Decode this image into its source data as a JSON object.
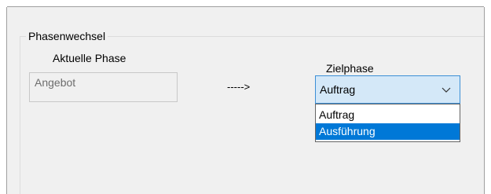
{
  "phase_change": {
    "group_title": "Phasenwechsel",
    "current_phase_label": "Aktuelle Phase",
    "current_phase_value": "Angebot",
    "arrow_text": "----->",
    "target_phase_label": "Zielphase",
    "target_phase_selected": "Auftrag",
    "target_phase_options": [
      "Auftrag",
      "Ausführung"
    ],
    "highlighted_option": "Ausführung",
    "icons": {
      "dropdown_arrow": "chevron-down-icon"
    },
    "colors": {
      "selection_highlight": "#0078d7",
      "combo_focus_fill": "#d4e8f8",
      "combo_focus_border": "#3c8fd6",
      "disabled_text": "#6d6d6d"
    }
  }
}
